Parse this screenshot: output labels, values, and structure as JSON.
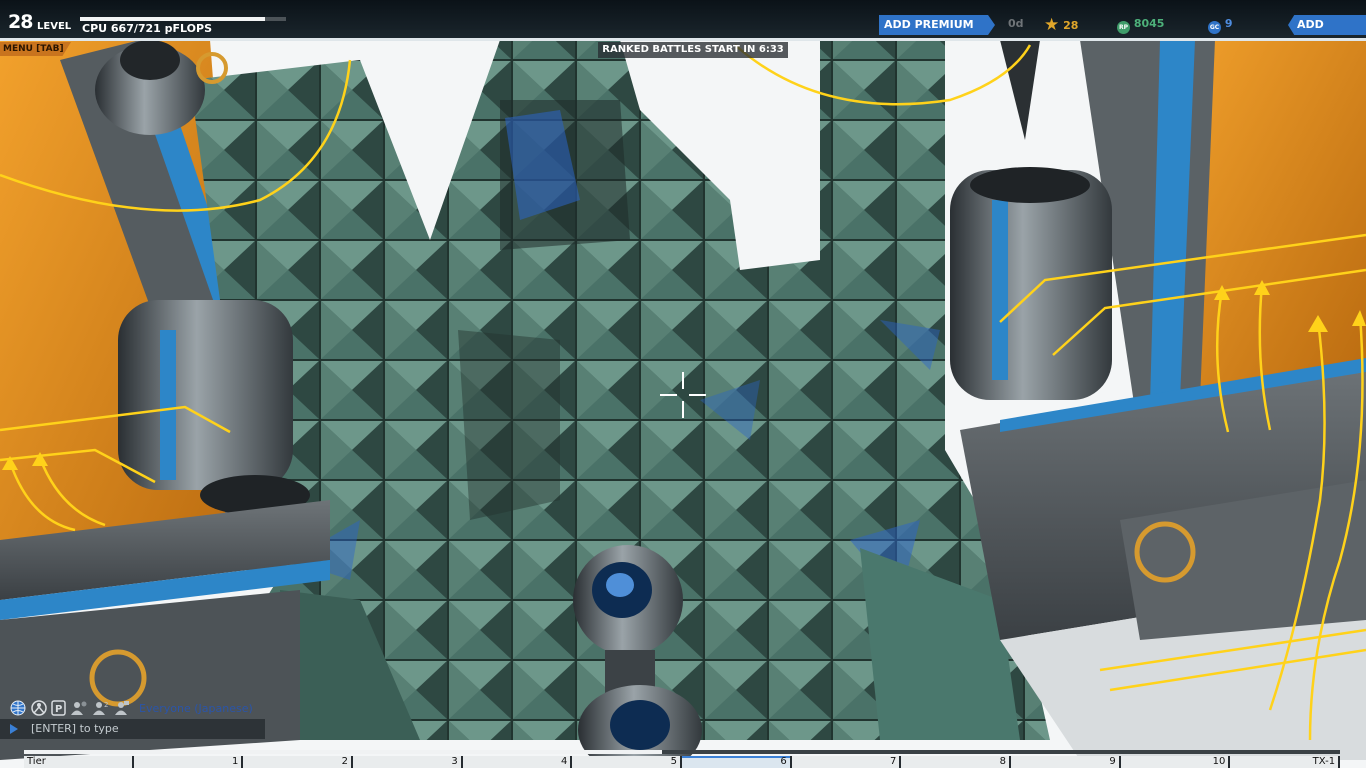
{
  "hud": {
    "level_number": "28",
    "level_label": "LEVEL",
    "level_progress": 0.9,
    "cpu": "CPU 667/721 pFLOPS",
    "menu_tab": "MENU [TAB]",
    "ranked_banner": "RANKED BATTLES START IN 6:33",
    "add_premium": "ADD PREMIUM",
    "premium_days": "0d",
    "stars": "28",
    "robits": "8045",
    "galaxy_coins": "9",
    "add_funds": "ADD FUNDS",
    "colors": {
      "accent_blue": "#2f73c8",
      "menu_orange": "#c9741e",
      "stars_gold": "#e0a62a",
      "robits_green": "#4db07a",
      "gc_blue": "#4f8de0"
    },
    "icons": [
      "star-icon",
      "robits-icon",
      "galaxy-coins-icon"
    ]
  },
  "chat": {
    "icons": [
      "globe-icon",
      "clan-icon",
      "party-icon",
      "friends-icon",
      "custom-channel-icon",
      "private-channel-icon"
    ],
    "channel": "Everyone (Japanese)",
    "input_hint": "[ENTER] to type"
  },
  "scene": {
    "description_icon": "crosshair-icon"
  },
  "bottom": {
    "cpu_progress": 0.485,
    "tiers": [
      {
        "label": "Tier",
        "active": false
      },
      {
        "label": "1",
        "active": false
      },
      {
        "label": "2",
        "active": false
      },
      {
        "label": "3",
        "active": false
      },
      {
        "label": "4",
        "active": false
      },
      {
        "label": "5",
        "active": false
      },
      {
        "label": "6",
        "active": true
      },
      {
        "label": "7",
        "active": false
      },
      {
        "label": "8",
        "active": false
      },
      {
        "label": "9",
        "active": false
      },
      {
        "label": "10",
        "active": false
      },
      {
        "label": "TX-1",
        "active": false
      }
    ]
  }
}
